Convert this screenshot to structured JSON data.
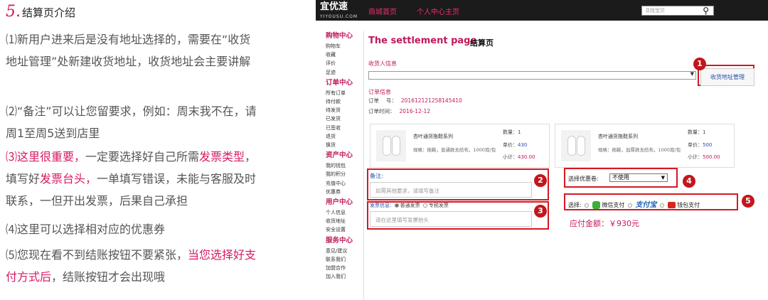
{
  "section": {
    "number": "5.",
    "title": "结算页介绍"
  },
  "notes": [
    {
      "parts": [
        {
          "t": "⑴新用户进来后是没有地址选择的，需要在“收货地址管理”处新建收货地址，收货地址会主要讲解",
          "red": false
        }
      ]
    },
    {
      "parts": [
        {
          "t": "⑵“备注”可以让您留要求，例如：周末我不在，请周1至周5送到店里",
          "red": false
        }
      ]
    },
    {
      "parts": [
        {
          "t": "⑶这里很重要，",
          "red": true
        },
        {
          "t": "一定要选择好自己所需",
          "red": false
        },
        {
          "t": "发票类型",
          "red": true
        },
        {
          "t": "，填写好",
          "red": false
        },
        {
          "t": "发票台头，",
          "red": true
        },
        {
          "t": "一单填写错误，未能与客服及时联系，一但开出发票，后果自己承担",
          "red": false
        }
      ]
    },
    {
      "parts": [
        {
          "t": "⑷这里可以选择相对应的优惠券",
          "red": false
        }
      ]
    },
    {
      "parts": [
        {
          "t": "⑸您现在看不到结账按钮不要紧张，",
          "red": false
        },
        {
          "t": "当您选择好支付方式后",
          "red": true
        },
        {
          "t": "，结账按钮才会出现哦",
          "red": false
        }
      ]
    }
  ],
  "site": {
    "logo": "宜优速",
    "logo_sub": "YIYOUSU.COM",
    "nav": [
      "商城首页",
      "个人中心主页"
    ],
    "search_placeholder": "寻找宝贝"
  },
  "sidebar": [
    {
      "group": "购物中心",
      "items": [
        "购物车",
        "收藏",
        "评价",
        "足迹"
      ]
    },
    {
      "group": "订单中心",
      "items": [
        "所有订单",
        "待付款",
        "待发货",
        "已发货",
        "已签收",
        "退货",
        "换货"
      ]
    },
    {
      "group": "资产中心",
      "items": [
        "我的钱包",
        "我的积分",
        "充值中心",
        "优惠券"
      ]
    },
    {
      "group": "用户中心",
      "items": [
        "个人信息",
        "收货地址",
        "安全设置"
      ]
    },
    {
      "group": "服务中心",
      "items": [
        "意见/建议",
        "联系我们",
        "加盟合作",
        "加入我们"
      ]
    }
  ],
  "page": {
    "title_en": "The settlement page",
    "title_cn": "结算页",
    "receiver_label": "收货人信息",
    "address_button": "收货地址管理",
    "order_label": "订单信息",
    "order_no_label": "订单　 号：",
    "order_no": "201612121258145410",
    "order_time_label": "订单时间：",
    "order_time": "2016-12-12",
    "products": [
      {
        "name": "杏叶通货拖鞋系列",
        "spec": "规格：拖鞋，普通款无纺布，1000双/包",
        "qty_label": "数量：",
        "qty": "1",
        "unit_label": "单价：",
        "unit": "430",
        "sub_label": "小计：",
        "sub": "430.00"
      },
      {
        "name": "杏叶通货拖鞋系列",
        "spec": "规格：拖鞋，加厚款无纺布，1000双/包",
        "qty_label": "数量：",
        "qty": "1",
        "unit_label": "单价：",
        "unit": "500",
        "sub_label": "小计：",
        "sub": "500.00"
      }
    ],
    "remark_label": "备注:",
    "remark_placeholder": "如需其他要求，请填写备注",
    "invoice_label": "发票信息:",
    "invoice_opt1": "普通发票",
    "invoice_opt2": "专税发票",
    "invoice_placeholder": "请在这里填写发票抬头",
    "coupon_label": "选择优惠卷:",
    "coupon_value": "不使用",
    "pay_label": "选择:",
    "pay_wechat": "微信支付",
    "pay_alipay": "支付宝",
    "pay_wallet": "钱包支付",
    "total_label": "应付金额：",
    "total_value": "￥930元"
  },
  "badges": [
    "1",
    "2",
    "3",
    "4",
    "5"
  ],
  "colors": {
    "accent": "#c0185a",
    "marker": "#c2161d",
    "topbar": "#1b1b1b"
  }
}
